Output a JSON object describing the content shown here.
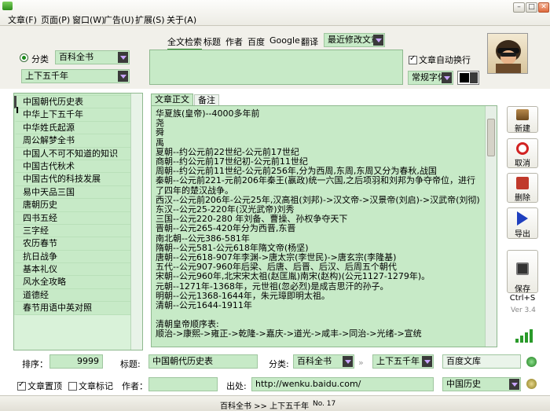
{
  "menu": {
    "items": [
      "文章(F)",
      "页面(P)",
      "窗口(W)",
      "广告(U)",
      "扩展(S)",
      "关于(A)"
    ]
  },
  "search": {
    "tabs": [
      "全文检索",
      "标题",
      "作者",
      "百度",
      "Google",
      "翻译"
    ],
    "sort_selected": "最近修改文章"
  },
  "category": {
    "label": "分类",
    "primary": "百科全书",
    "secondary": "上下五千年"
  },
  "options": {
    "auto_wrap_label": "文章自动换行",
    "font_selected": "常规字体"
  },
  "list": {
    "items": [
      "中国朝代历史表",
      "中华上下五千年",
      "中华姓氏起源",
      "周公解梦全书",
      "中国人不可不知道的知识",
      "中国古代秋术",
      "中国古代的科技发展",
      "易中天品三国",
      "唐朝历史",
      "四书五经",
      "三字经",
      "农历春节",
      "抗日战争",
      "基本礼仪",
      "风水全攻略",
      "道德经",
      "春节用语中英对照"
    ]
  },
  "doc_tabs": [
    "文章正文",
    "备注"
  ],
  "content": {
    "lines": [
      "华夏族(皇帝)--4000多年前",
      "尧",
      "舜",
      "禹",
      "夏朝--约公元前22世纪-公元前17世纪",
      "商朝--约公元前17世纪初-公元前11世纪",
      "周朝--约公元前11世纪-公元前256年,分为西周,东周,东周又分为春秋,战国",
      "秦朝--公元前221-元前206年秦王(嬴政)统一六国,之后项羽和刘邦为争夺帝位，进行了四年的楚汉战争。",
      "西汉--公元前206年-公元25年,汉高祖(刘邦)->汉文帝->汉景帝(刘启)->汉武帝(刘彻)",
      "东汉--公元25-220年(汉光武帝)刘秀",
      "三国--公元220-280 年刘备、曹操、孙权争夺天下",
      "晋朝--公元265-420年分为西晋,东晋",
      "南北朝--公元386-581年",
      "隋朝--公元581-公元618年隋文帝(杨坚)",
      "唐朝--公元618-907年李渊->唐太宗(李世民)->唐玄宗(李隆基)",
      "五代--公元907-960年后梁、后唐、后晋、后汉、后周五个朝代",
      "宋朝--公元960年,北宋宋太祖(赵匡胤)南宋(赵构)(公元1127-1279年)。",
      "元朝--1271年-1368年，元世祖(忽必烈)是成吉思汗的孙子。",
      "明朝--公元1368-1644年，朱元璋即明太祖。",
      "清朝--公元1644-1911年",
      "",
      "清朝皇帝顺序表:",
      "顺治->康熙->雍正->乾隆->嘉庆->道光->咸丰->同治->光绪->宣统"
    ]
  },
  "side_buttons": [
    {
      "label": "新建",
      "color": "#7a5a2e"
    },
    {
      "label": "取消",
      "color": "#d22222"
    },
    {
      "label": "删除",
      "color": "#c0392b"
    },
    {
      "label": "导出",
      "color": "#1f3fbf"
    },
    {
      "label": "保存\nCtrl+S",
      "color": "#333333"
    }
  ],
  "version": "Ver 3.4",
  "fields": {
    "sort_label": "排序：",
    "sort_value": "9999",
    "title_label": "标题:",
    "title_value": "中国朝代历史表",
    "cat_label": "分类:",
    "cat_primary": "百科全书",
    "cat_secondary": "上下五千年",
    "library": "百度文库",
    "pin_label": "文章置顶",
    "mark_label": "文章标记",
    "author_label": "作者：",
    "author_value": "",
    "source_label": "出处:",
    "source_value": "http://wenku.baidu.com/",
    "source_tag": "中国历史"
  },
  "status": {
    "path": "百科全书 >> 上下五千年",
    "number": "No. 17"
  },
  "colors": {
    "field_bg": "#c7eac7",
    "accent": "#2a8a2a"
  }
}
